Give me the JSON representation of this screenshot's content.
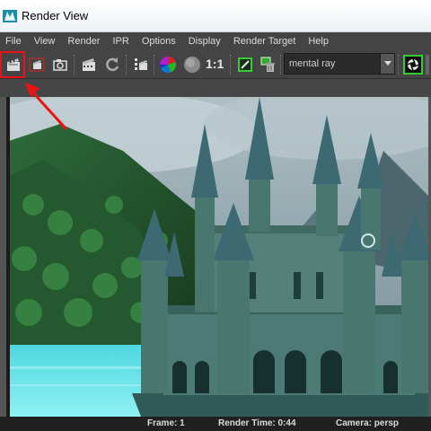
{
  "window": {
    "title": "Render View"
  },
  "menu": [
    "File",
    "View",
    "Render",
    "IPR",
    "Options",
    "Display",
    "Render Target",
    "Help"
  ],
  "toolbar": {
    "ratio_label": "1:1",
    "renderer": "mental ray",
    "buttons": {
      "redo_render": "clapper-redo-icon",
      "render_region": "clapper-region-icon",
      "snapshot": "camera-snapshot-icon",
      "ipr_render": "ipr-clapper-icon",
      "refresh_ipr": "refresh-icon",
      "render_settings": "render-settings-icon",
      "rgb_channels": "rgb-channels-icon",
      "alpha_channel": "alpha-channel-icon",
      "keep_image": "keep-image-icon",
      "remove_image": "remove-image-icon",
      "render_sequence": "render-sequence-icon"
    }
  },
  "status": {
    "frame": "Frame: 1",
    "render_time": "Render Time: 0:44",
    "camera": "Camera: persp"
  },
  "annotation": {
    "highlight_color": "#ee1111"
  }
}
